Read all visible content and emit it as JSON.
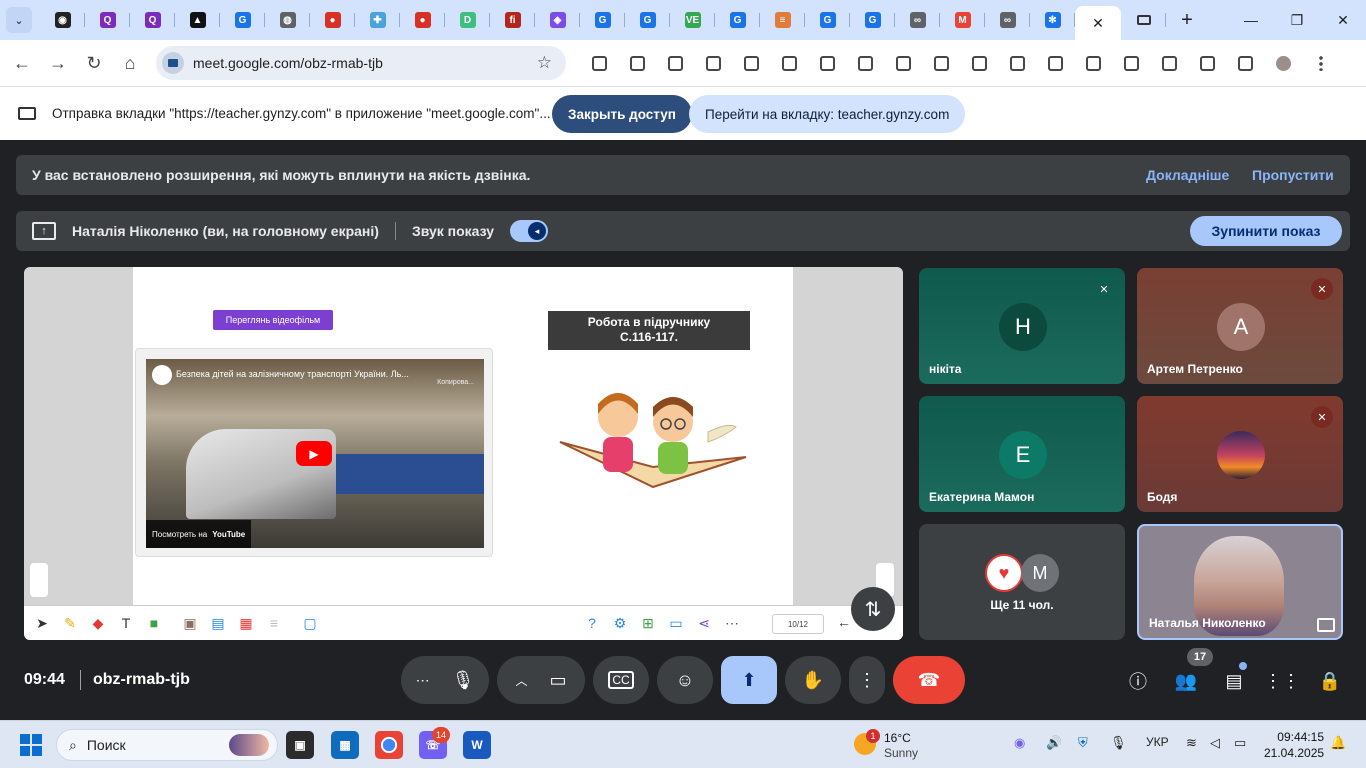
{
  "browser": {
    "tabs": [
      {
        "icon": "tab-favicon-1",
        "color": "#222222",
        "glyph": "◉"
      },
      {
        "icon": "tab-favicon-quizizz",
        "color": "#7b2cbf",
        "glyph": "Q"
      },
      {
        "icon": "tab-favicon-quizizz-2",
        "color": "#7b2cbf",
        "glyph": "Q"
      },
      {
        "icon": "tab-favicon-drive",
        "color": "#111111",
        "glyph": "▲"
      },
      {
        "icon": "tab-favicon-grammarly",
        "color": "#1a73e8",
        "glyph": "G"
      },
      {
        "icon": "tab-favicon-globe",
        "color": "#5f6368",
        "glyph": "◍"
      },
      {
        "icon": "tab-favicon-red-1",
        "color": "#d93025",
        "glyph": "●"
      },
      {
        "icon": "tab-favicon-puzzle",
        "color": "#4aa3df",
        "glyph": "✚"
      },
      {
        "icon": "tab-favicon-red-2",
        "color": "#d93025",
        "glyph": "●"
      },
      {
        "icon": "tab-favicon-d",
        "color": "#3fbf7f",
        "glyph": "D"
      },
      {
        "icon": "tab-favicon-fi",
        "color": "#b3261e",
        "glyph": "fi"
      },
      {
        "icon": "tab-favicon-canva",
        "color": "#7b4ce6",
        "glyph": "◈"
      },
      {
        "icon": "tab-favicon-gynzy-1",
        "color": "#1a73e8",
        "glyph": "G"
      },
      {
        "icon": "tab-favicon-gynzy-2",
        "color": "#1a73e8",
        "glyph": "G"
      },
      {
        "icon": "tab-favicon-ve",
        "color": "#34a853",
        "glyph": "VE"
      },
      {
        "icon": "tab-favicon-gynzy-3",
        "color": "#1a73e8",
        "glyph": "G"
      },
      {
        "icon": "tab-favicon-books",
        "color": "#e07b39",
        "glyph": "≡"
      },
      {
        "icon": "tab-favicon-gynzy-4",
        "color": "#1a73e8",
        "glyph": "G"
      },
      {
        "icon": "tab-favicon-gynzy-5",
        "color": "#1a73e8",
        "glyph": "G"
      },
      {
        "icon": "tab-favicon-link-1",
        "color": "#5f6368",
        "glyph": "∞"
      },
      {
        "icon": "tab-favicon-gmail",
        "color": "#ea4335",
        "glyph": "M"
      },
      {
        "icon": "tab-favicon-link-2",
        "color": "#5f6368",
        "glyph": "∞"
      },
      {
        "icon": "tab-favicon-snowflake",
        "color": "#1a73e8",
        "glyph": "✻"
      }
    ],
    "address": "meet.google.com/obz-rmab-tjb"
  },
  "sharebar": {
    "text": "Отправка вкладки \"https://teacher.gynzy.com\" в приложение \"meet.google.com\"...",
    "stop_label": "Закрыть доступ",
    "goto_label": "Перейти на вкладку: teacher.gynzy.com"
  },
  "meet": {
    "warning": {
      "text": "У вас встановлено розширення, які можуть вплинути на якість дзвінка.",
      "learn_more": "Докладніше",
      "skip": "Пропустити"
    },
    "presenting": {
      "name": "Наталія Ніколенко (ви, на головному екрані)",
      "sound_label": "Звук показу",
      "stop_label": "Зупинити показ"
    },
    "slide": {
      "video_button": "Переглянь відеофільм",
      "box_line1": "Робота в підручнику",
      "box_line2": "С.116-117.",
      "video_title": "Безпека дітей на залізничному транспорті України. Ль...",
      "video_copy": "Копирова...",
      "watch_on": "Посмотреть на",
      "youtube": "YouTube",
      "page": "10/12"
    },
    "participants": [
      {
        "name": "нікіта",
        "initial": "Н",
        "avatar_color": "#0c4a3e"
      },
      {
        "name": "Артем Петренко",
        "initial": "А",
        "avatar_color": "#a0746a"
      },
      {
        "name": "Екатерина Мамон",
        "initial": "Е",
        "avatar_color": "#0d7a67"
      },
      {
        "name": "Бодя",
        "initial": "",
        "avatar_color": "#e86a2d"
      }
    ],
    "more": {
      "label": "Ще 11 чол.",
      "initial": "М"
    },
    "self_tile": {
      "name": "Наталья Николенко"
    },
    "time": "09:44",
    "code": "obz-rmab-tjb",
    "people_count": "17"
  },
  "taskbar": {
    "search": "Поиск",
    "viber_badge": "14",
    "weather_badge": "1",
    "temp": "16°C",
    "condition": "Sunny",
    "lang": "УКР",
    "time": "09:44:15",
    "date": "21.04.2025"
  }
}
